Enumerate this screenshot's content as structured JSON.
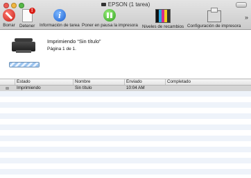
{
  "window": {
    "title": "EPSON (1 tarea)"
  },
  "toolbar": {
    "items": [
      {
        "label": "Borrar",
        "icon": "delete-icon"
      },
      {
        "label": "Detener",
        "icon": "hold-job-icon"
      },
      {
        "label": "Información de tarea",
        "icon": "info-icon"
      },
      {
        "label": "Poner en pausa la impresora",
        "icon": "pause-icon"
      },
      {
        "label": "Niveles de recambios",
        "icon": "supply-levels-icon"
      },
      {
        "label": "Configuración de impresora",
        "icon": "printer-settings-icon"
      }
    ],
    "overflow": "»"
  },
  "current_job": {
    "title": "Imprimiendo “Sin título”",
    "page": "Página 1 de 1."
  },
  "table": {
    "columns": [
      "Estado",
      "Nombre",
      "Enviado",
      "Completado"
    ],
    "rows": [
      {
        "estado": "Imprimiendo",
        "nombre": "Sin título",
        "enviado": "10:04 AM",
        "completado": ""
      }
    ]
  }
}
